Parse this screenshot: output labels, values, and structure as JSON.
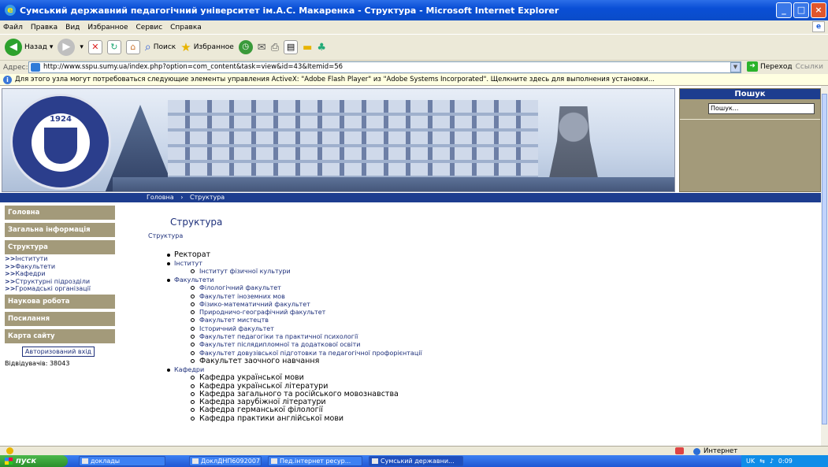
{
  "window": {
    "title": "Сумський державний педагогічний університет ім.А.С. Макаренка - Структура - Microsoft Internet Explorer",
    "controls": [
      "_",
      "□",
      "×"
    ]
  },
  "menu": [
    "Файл",
    "Правка",
    "Вид",
    "Избранное",
    "Сервис",
    "Справка"
  ],
  "toolbar": {
    "back": "Назад",
    "search": "Поиск",
    "favorites": "Избранное"
  },
  "address": {
    "label": "Адрес:",
    "url": "http://www.sspu.sumy.ua/index.php?option=com_content&task=view&id=43&Itemid=56",
    "go": "Переход",
    "links": "Ссылки"
  },
  "infobar": "Для этого узла могут потребоваться следующие элементы управления ActiveX: \"Adobe Flash Player\" из \"Adobe Systems Incorporated\". Щелкните здесь для выполнения установки...",
  "banner": {
    "seal_year": "1924"
  },
  "search": {
    "title": "Пошук",
    "placeholder": "Пошук..."
  },
  "breadcrumb": {
    "home": "Головна",
    "current": "Структура"
  },
  "sidebar": {
    "home": "Головна",
    "general": "Загальна інформація",
    "structure": "Структура",
    "sub": [
      "Інститути",
      "Факультети",
      "Кафедри",
      "Структурні підрозділи",
      "Громадські організації"
    ],
    "research": "Наукова робота",
    "links": "Посилання",
    "sitemap": "Карта сайту",
    "auth": "Авторизований вхід",
    "visits": "Відвідувачів: 38043"
  },
  "content": {
    "title": "Структура",
    "crumb": "Структура",
    "rectorate": "Ректорат",
    "institute": "Інститут",
    "institute_items": [
      "Інститут фізичної культури"
    ],
    "faculties": "Факультети",
    "faculty_items": [
      "Філологічний факультет",
      "Факультет іноземних мов",
      "Фізико-математичний факультет",
      "Природничо-географічний факультет",
      "Факультет мистецтв",
      "Історичний факультет",
      "Факультет педагогіки та практичної психології",
      "Факультет післядипломної та додаткової освіти",
      "Факультет довузівської підготовки та педагогічної профорієнтації",
      "Факультет заочного навчання"
    ],
    "departments": "Кафедри",
    "department_items": [
      "Кафедра української мови",
      "Кафедра української літератури",
      "Кафедра загального та російського мовознавства",
      "Кафедра зарубіжної літератури",
      "Кафедра германської філології",
      "Кафедра практики англійської мови"
    ]
  },
  "status": {
    "zone": "Интернет"
  },
  "taskbar": {
    "start": "пуск",
    "tasks": [
      "доклады",
      "ДоклДНП6092007 - ...",
      "Пед.інтернет ресур...",
      "Сумський державни..."
    ],
    "lang": "UK",
    "clock": "0:09"
  }
}
